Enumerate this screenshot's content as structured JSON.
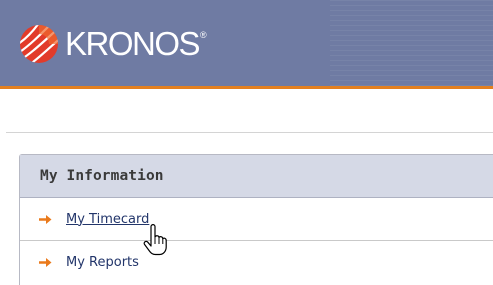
{
  "header": {
    "logo_text": "KRONOS",
    "logo_mark": "®",
    "logo_icon": "kronos-globe-logo",
    "background_color": "#6f7ba3",
    "accent_color": "#e4801f"
  },
  "panel": {
    "title": "My Information",
    "items": [
      {
        "label": "My Timecard",
        "icon": "orange-arrow-icon",
        "hovered": true
      },
      {
        "label": "My Reports",
        "icon": "orange-arrow-icon",
        "hovered": false
      }
    ]
  },
  "cursor": {
    "icon": "hand-pointer-icon"
  }
}
